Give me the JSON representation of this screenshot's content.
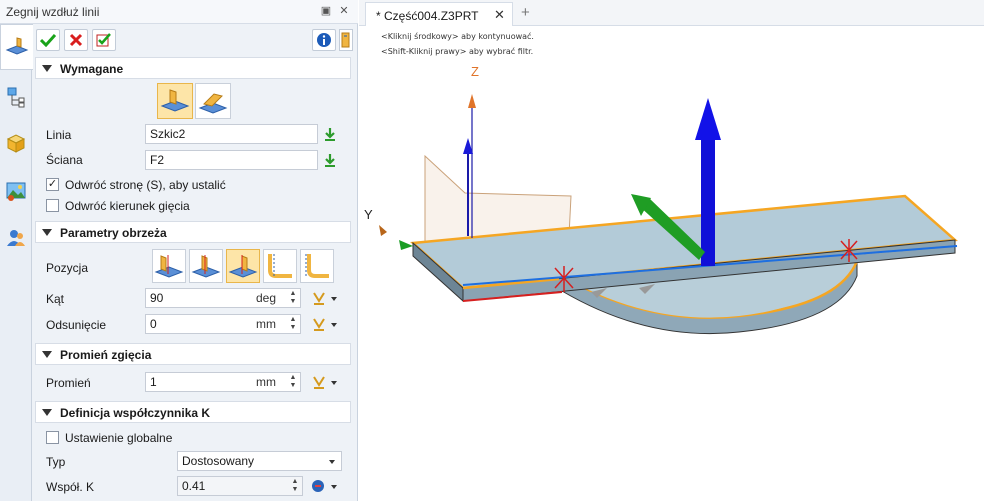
{
  "dock": {
    "title": "Zegnij wzdłuż linii",
    "pin_glyph": "▣",
    "close_glyph": "✕"
  },
  "side_tabs": [
    "bend-feature-icon",
    "history-tree-icon",
    "part-view-icon",
    "render-icon",
    "user-icon"
  ],
  "toolbar": {
    "ok": "OK",
    "cancel": "Cancel",
    "apply": "Apply",
    "info": "i"
  },
  "required": {
    "header": "Wymagane",
    "line_label": "Linia",
    "line_value": "Szkic2",
    "face_label": "Ściana",
    "face_value": "F2",
    "flip_side_label": "Odwróć stronę (S), aby ustalić",
    "flip_side_checked": true,
    "flip_dir_label": "Odwróć kierunek gięcia",
    "flip_dir_checked": false
  },
  "trim": {
    "header": "Parametry obrzeża",
    "position_label": "Pozycja",
    "selected_position_index": 2,
    "angle_label": "Kąt",
    "angle_value": "90",
    "angle_unit": "deg",
    "offset_label": "Odsunięcie",
    "offset_value": "0",
    "offset_unit": "mm"
  },
  "bend_radius": {
    "header": "Promień zgięcia",
    "radius_label": "Promień",
    "radius_value": "1",
    "radius_unit": "mm"
  },
  "kfactor": {
    "header": "Definicja współczynnika K",
    "global_label": "Ustawienie globalne",
    "global_checked": false,
    "type_label": "Typ",
    "type_value": "Dostosowany",
    "k_label": "Współ. K",
    "k_value": "0.41"
  },
  "tab": {
    "label": "* Część004.Z3PRT",
    "close": "✕",
    "add": "+"
  },
  "viewport": {
    "hint1": "<Kliknij środkowy> aby kontynuować.",
    "hint2": "<Shift-Kliknij prawy> aby wybrać filtr.",
    "z_axis": "Z",
    "y_axis": "Y"
  },
  "colors": {
    "part_fill": "#a9c3d3",
    "edge_highlight": "#f5a623",
    "arrow_blue": "#1010d8",
    "arrow_green": "#1f9d24"
  }
}
